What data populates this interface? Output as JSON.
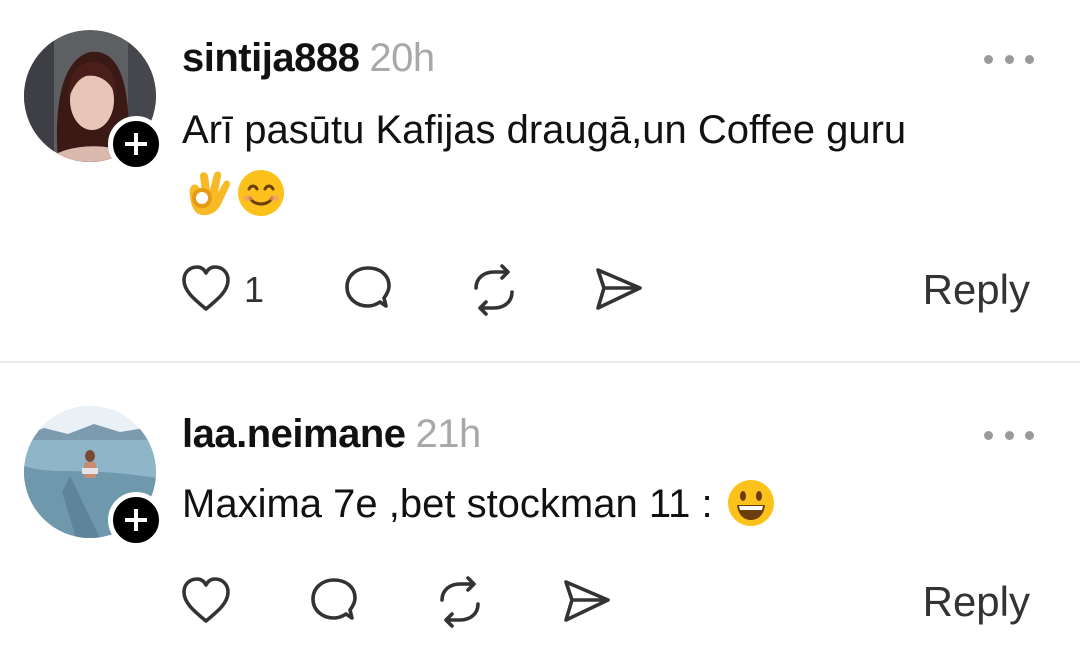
{
  "comments": [
    {
      "username": "sintija888",
      "time": "20h",
      "text": "Arī pasūtu Kafijas draugā,un Coffee guru",
      "emoji": [
        "ok-hand",
        "smiling-face"
      ],
      "like_count": "1",
      "reply_label": "Reply"
    },
    {
      "username": "laa.neimane",
      "time": "21h",
      "text": "Maxima 7e ,bet stockman 11 :",
      "emoji": [
        "grinning-face"
      ],
      "like_count": "",
      "reply_label": "Reply"
    }
  ]
}
